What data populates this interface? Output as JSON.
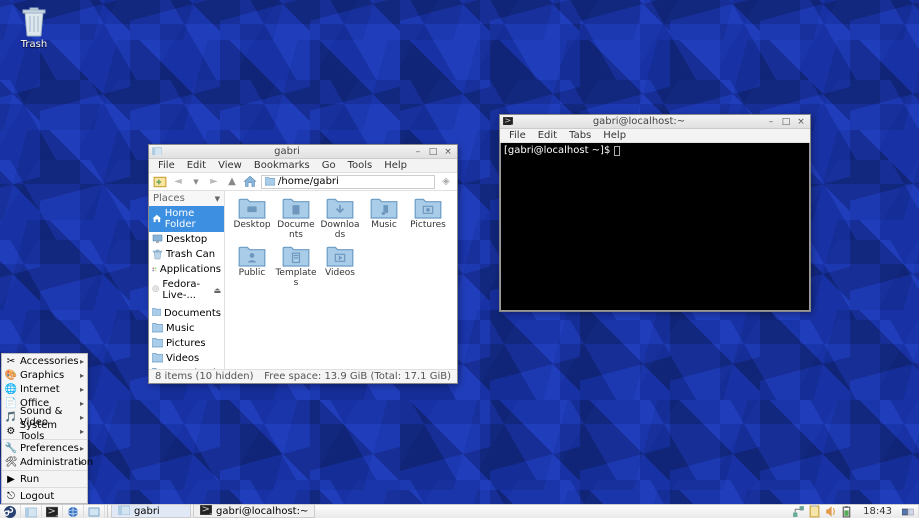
{
  "desktop": {
    "trash_label": "Trash"
  },
  "startmenu": {
    "items": [
      {
        "label": "Accessories",
        "icon": "scissors",
        "arrow": true
      },
      {
        "label": "Graphics",
        "icon": "palette",
        "arrow": true
      },
      {
        "label": "Internet",
        "icon": "globe",
        "arrow": true
      },
      {
        "label": "Office",
        "icon": "doc",
        "arrow": true
      },
      {
        "label": "Sound & Video",
        "icon": "media",
        "arrow": true
      },
      {
        "label": "System Tools",
        "icon": "gears",
        "arrow": true
      }
    ],
    "items2": [
      {
        "label": "Preferences",
        "icon": "pref",
        "arrow": true
      },
      {
        "label": "Administration",
        "icon": "admin",
        "arrow": true
      }
    ],
    "items3": [
      {
        "label": "Run",
        "icon": "run",
        "arrow": false
      }
    ],
    "items4": [
      {
        "label": "Logout",
        "icon": "logout",
        "arrow": false
      }
    ]
  },
  "panel": {
    "tasks": [
      {
        "label": "gabri",
        "icon": "fm",
        "active": true
      },
      {
        "label": "gabri@localhost:~",
        "icon": "term",
        "active": false
      }
    ],
    "clock": "18:43"
  },
  "fm": {
    "title": "gabri",
    "menu": [
      "File",
      "Edit",
      "View",
      "Bookmarks",
      "Go",
      "Tools",
      "Help"
    ],
    "path": "/home/gabri",
    "side_header": "Places",
    "places": [
      {
        "label": "Home Folder",
        "icon": "home",
        "sel": true
      },
      {
        "label": "Desktop",
        "icon": "desktop"
      },
      {
        "label": "Trash Can",
        "icon": "trash"
      },
      {
        "label": "Applications",
        "icon": "apps"
      },
      {
        "label": "Fedora-Live-...",
        "icon": "disc",
        "eject": true
      }
    ],
    "bookmarks": [
      {
        "label": "Documents",
        "icon": "folder"
      },
      {
        "label": "Music",
        "icon": "folder"
      },
      {
        "label": "Pictures",
        "icon": "folder"
      },
      {
        "label": "Videos",
        "icon": "folder"
      },
      {
        "label": "Downloads",
        "icon": "folder"
      }
    ],
    "items": [
      {
        "label": "Desktop"
      },
      {
        "label": "Documents"
      },
      {
        "label": "Downloads"
      },
      {
        "label": "Music"
      },
      {
        "label": "Pictures"
      },
      {
        "label": "Public"
      },
      {
        "label": "Templates"
      },
      {
        "label": "Videos"
      }
    ],
    "status_left": "8 items (10 hidden)",
    "status_right": "Free space: 13.9 GiB (Total: 17.1 GiB)"
  },
  "term": {
    "title": "gabri@localhost:~",
    "menu": [
      "File",
      "Edit",
      "Tabs",
      "Help"
    ],
    "prompt": "[gabri@localhost ~]$ "
  }
}
